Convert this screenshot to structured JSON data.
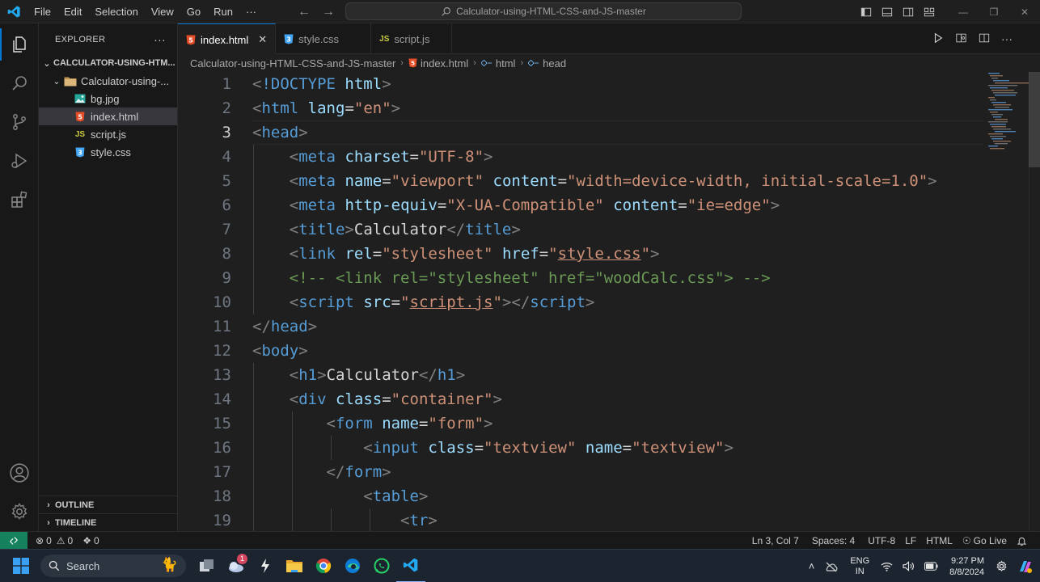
{
  "titlebar": {
    "menu": [
      "File",
      "Edit",
      "Selection",
      "View",
      "Go",
      "Run",
      "···"
    ],
    "search_text": "Calculator-using-HTML-CSS-and-JS-master"
  },
  "sidebar": {
    "header": "EXPLORER",
    "more": "···",
    "root": "CALCULATOR-USING-HTM...",
    "folder": "Calculator-using-...",
    "files": [
      {
        "name": "bg.jpg",
        "icon": "image-file-icon"
      },
      {
        "name": "index.html",
        "icon": "html5-file-icon"
      },
      {
        "name": "script.js",
        "icon": "js-file-icon"
      },
      {
        "name": "style.css",
        "icon": "css3-file-icon"
      }
    ],
    "outline": "OUTLINE",
    "timeline": "TIMELINE"
  },
  "tabs": [
    {
      "label": "index.html",
      "active": true
    },
    {
      "label": "style.css",
      "active": false
    },
    {
      "label": "script.js",
      "active": false
    }
  ],
  "breadcrumb": {
    "root": "Calculator-using-HTML-CSS-and-JS-master",
    "file": "index.html",
    "el1": "html",
    "el2": "head"
  },
  "editor": {
    "current_line": 3,
    "line_numbers": [
      "1",
      "2",
      "3",
      "4",
      "5",
      "6",
      "7",
      "8",
      "9",
      "10",
      "11",
      "12",
      "13",
      "14",
      "15",
      "16",
      "17",
      "18",
      "19"
    ]
  },
  "statusbar": {
    "errors": "0",
    "warnings": "0",
    "ports": "0",
    "position": "Ln 3, Col 7",
    "spaces": "Spaces: 4",
    "encoding": "UTF-8",
    "eol": "LF",
    "language": "HTML",
    "golive": "Go Live"
  },
  "taskbar": {
    "search": "Search",
    "notification_count": "1",
    "lang1": "ENG",
    "lang2": "IN",
    "time": "9:27 PM",
    "date": "8/8/2024"
  },
  "colors": {
    "accent": "#0078d4",
    "remote": "#16825d",
    "html_icon": "#e44d26",
    "css_icon": "#42a5f5",
    "js_icon": "#cbcb41"
  }
}
